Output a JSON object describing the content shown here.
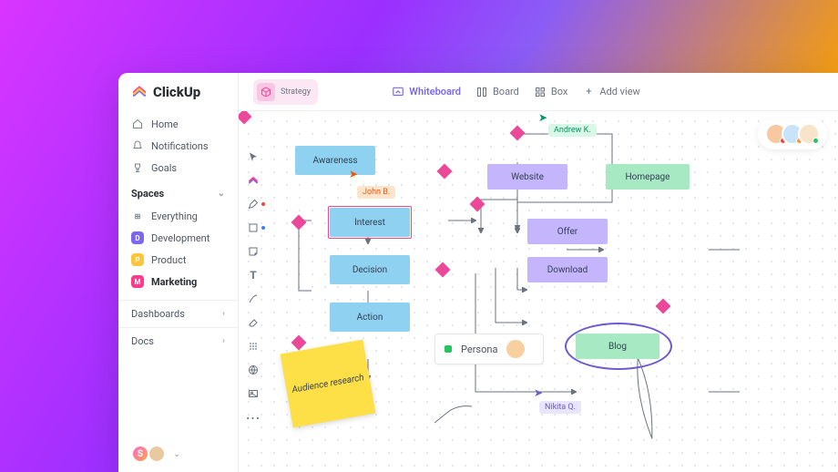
{
  "brand": "ClickUp",
  "nav": {
    "home": "Home",
    "notifications": "Notifications",
    "goals": "Goals"
  },
  "spaces": {
    "title": "Spaces",
    "everything": "Everything",
    "items": [
      {
        "letter": "D",
        "label": "Development"
      },
      {
        "letter": "P",
        "label": "Product"
      },
      {
        "letter": "M",
        "label": "Marketing"
      }
    ]
  },
  "sections": {
    "dashboards": "Dashboards",
    "docs": "Docs"
  },
  "breadcrumb": "Strategy",
  "views": {
    "whiteboard": "Whiteboard",
    "board": "Board",
    "box": "Box",
    "add": "Add view"
  },
  "nodes": {
    "awareness": "Awareness",
    "interest": "Interest",
    "decision": "Decision",
    "action": "Action",
    "website": "Website",
    "homepage": "Homepage",
    "offer": "Offer",
    "download": "Download",
    "blog": "Blog",
    "persona": "Persona"
  },
  "sticky": "Audience research",
  "cursors": {
    "andrew": "Andrew K.",
    "john": "John B.",
    "nikita": "Nikita Q."
  },
  "colors": {
    "accent_purple": "#7b68ee",
    "accent_pink": "#ec4899",
    "node_blue": "#8ed1f0",
    "node_purple": "#c4b5fd",
    "node_green": "#a7e9c3",
    "sticky": "#fde047"
  },
  "footer_user_initial": "S"
}
